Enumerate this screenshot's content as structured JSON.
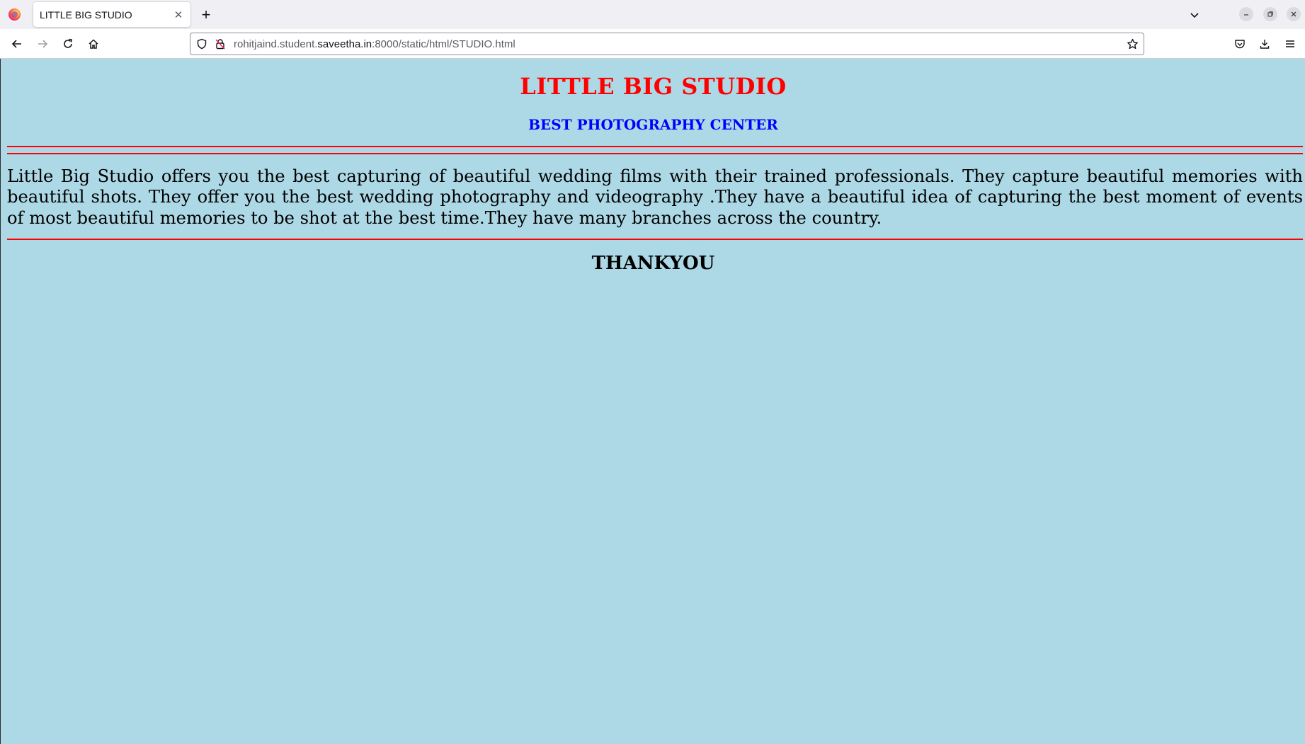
{
  "browser": {
    "tab": {
      "title": "LITTLE BIG STUDIO",
      "close_glyph": "✕"
    },
    "new_tab_glyph": "+",
    "url": {
      "prefix": "rohitjaind.student.",
      "host": "saveetha.in",
      "suffix": ":8000/static/html/STUDIO.html"
    },
    "icons": {
      "back": "arrow-left-icon",
      "forward": "arrow-right-icon",
      "reload": "reload-icon",
      "home": "home-icon",
      "shield": "shield-icon",
      "insecure": "insecure-lock-icon",
      "bookmark": "star-icon",
      "pocket": "pocket-icon",
      "downloads": "download-icon",
      "menu": "hamburger-menu-icon"
    }
  },
  "page": {
    "background": "#add8e6",
    "heading": "LITTLE BIG STUDIO",
    "heading_color": "#ff0000",
    "subheading": "BEST PHOTOGRAPHY CENTER",
    "subheading_color": "#0000ff",
    "rule_color": "#ff0000",
    "description": "Little Big Studio offers you the best capturing of beautiful wedding films with their trained professionals. They capture beautiful memories with beautiful shots. They offer you the best wedding photography and videography .They have a beautiful idea of capturing the best moment of events of most beautiful memories to be shot at the best time.They have many branches across the country.",
    "footer": "THANKYOU"
  }
}
